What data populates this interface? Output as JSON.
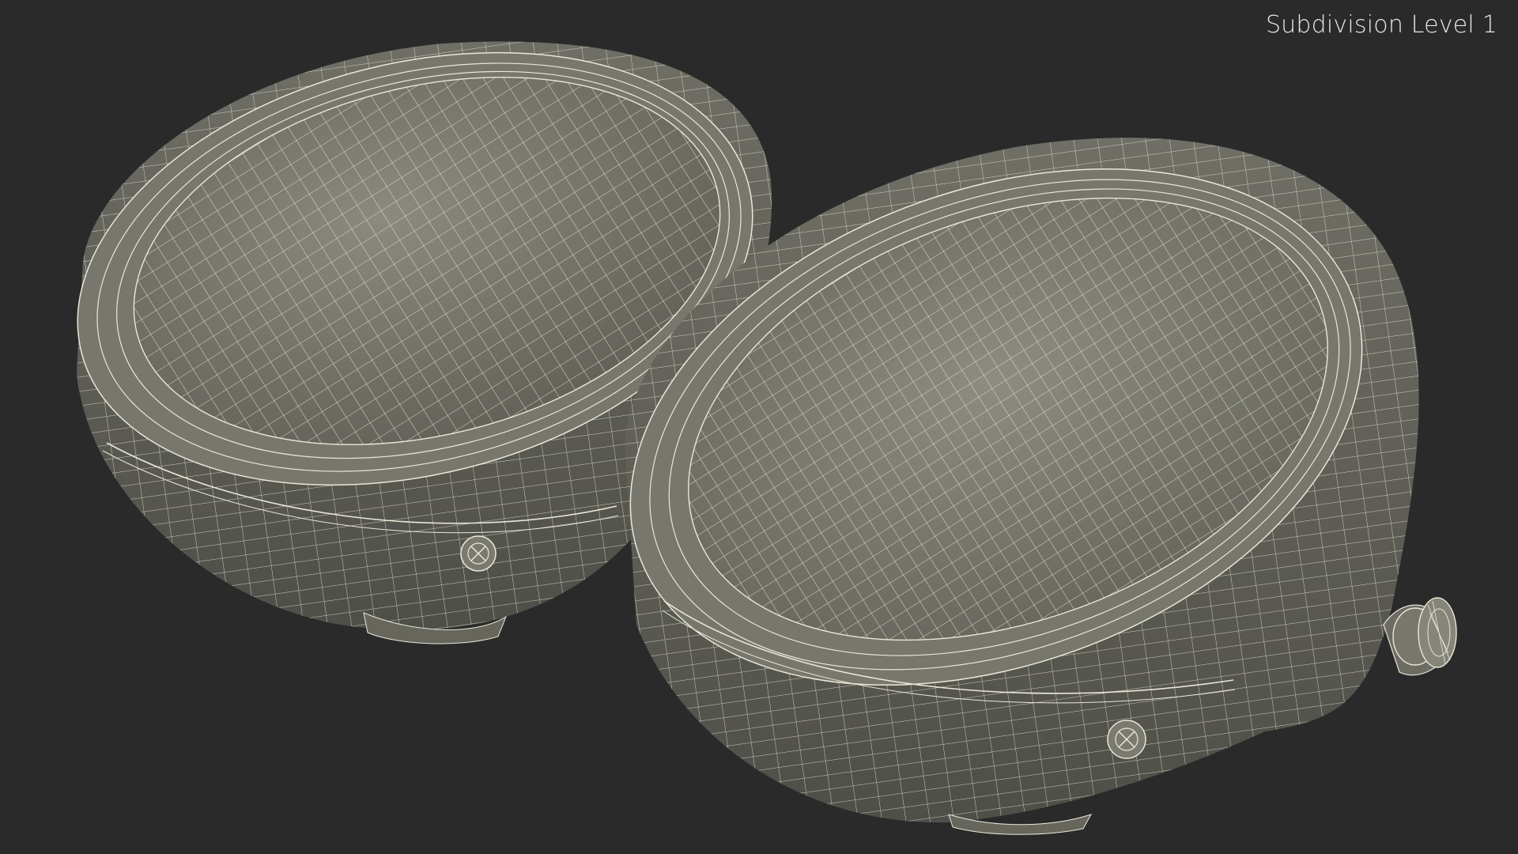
{
  "viewport": {
    "label": "Subdivision Level 1",
    "background_color": "#2a2a2a",
    "mesh_fill_color": "#7b7b70",
    "wire_color": "#e9e7d7",
    "objects": [
      {
        "name": "left-headlight-housing",
        "has_adjuster_knob": false
      },
      {
        "name": "right-headlight-housing",
        "has_adjuster_knob": true
      }
    ]
  }
}
